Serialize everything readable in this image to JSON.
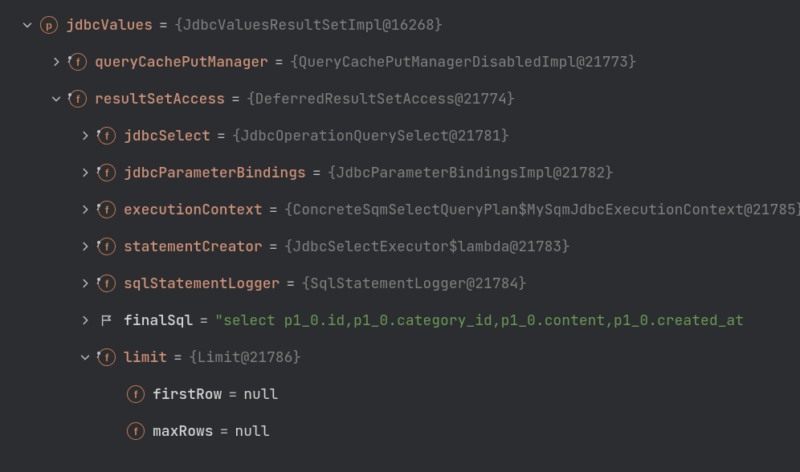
{
  "rows": [
    {
      "indent": 24,
      "arrow": "down",
      "icon": "p",
      "nameClass": "var-name",
      "name": "jdbcValues",
      "valClass": "val-obj",
      "value": "{JdbcValuesResultSetImpl@16268}"
    },
    {
      "indent": 60,
      "arrow": "right",
      "icon": "fpin",
      "nameClass": "var-name",
      "name": "queryCachePutManager",
      "valClass": "val-obj",
      "value": "{QueryCachePutManagerDisabledImpl@21773}"
    },
    {
      "indent": 60,
      "arrow": "down",
      "icon": "fpin",
      "nameClass": "var-name",
      "name": "resultSetAccess",
      "valClass": "val-obj",
      "value": "{DeferredResultSetAccess@21774}"
    },
    {
      "indent": 96,
      "arrow": "right",
      "icon": "fpin",
      "nameClass": "var-name",
      "name": "jdbcSelect",
      "valClass": "val-obj",
      "value": "{JdbcOperationQuerySelect@21781}"
    },
    {
      "indent": 96,
      "arrow": "right",
      "icon": "fpin",
      "nameClass": "var-name",
      "name": "jdbcParameterBindings",
      "valClass": "val-obj",
      "value": "{JdbcParameterBindingsImpl@21782}"
    },
    {
      "indent": 96,
      "arrow": "right",
      "icon": "fpin",
      "nameClass": "var-name",
      "name": "executionContext",
      "valClass": "val-obj",
      "value": "{ConcreteSqmSelectQueryPlan$MySqmJdbcExecutionContext@21785}"
    },
    {
      "indent": 96,
      "arrow": "right",
      "icon": "fpin",
      "nameClass": "var-name",
      "name": "statementCreator",
      "valClass": "val-obj",
      "value": "{JdbcSelectExecutor$lambda@21783}"
    },
    {
      "indent": 96,
      "arrow": "right",
      "icon": "fpin",
      "nameClass": "var-name",
      "name": "sqlStatementLogger",
      "valClass": "val-obj",
      "value": "{SqlStatementLogger@21784}"
    },
    {
      "indent": 96,
      "arrow": "right",
      "icon": "flag",
      "nameClass": "var-name white",
      "name": "finalSql",
      "valClass": "val-str",
      "value": "\"select p1_0.id,p1_0.category_id,p1_0.content,p1_0.created_at"
    },
    {
      "indent": 96,
      "arrow": "down",
      "icon": "fpin",
      "nameClass": "var-name",
      "name": "limit",
      "valClass": "val-obj",
      "value": "{Limit@21786}"
    },
    {
      "indent": 132,
      "arrow": "none",
      "icon": "f",
      "nameClass": "var-name white",
      "name": "firstRow",
      "valClass": "val-null",
      "value": "null"
    },
    {
      "indent": 132,
      "arrow": "none",
      "icon": "f",
      "nameClass": "var-name white",
      "name": "maxRows",
      "valClass": "val-null",
      "value": "null"
    }
  ],
  "eq": "="
}
